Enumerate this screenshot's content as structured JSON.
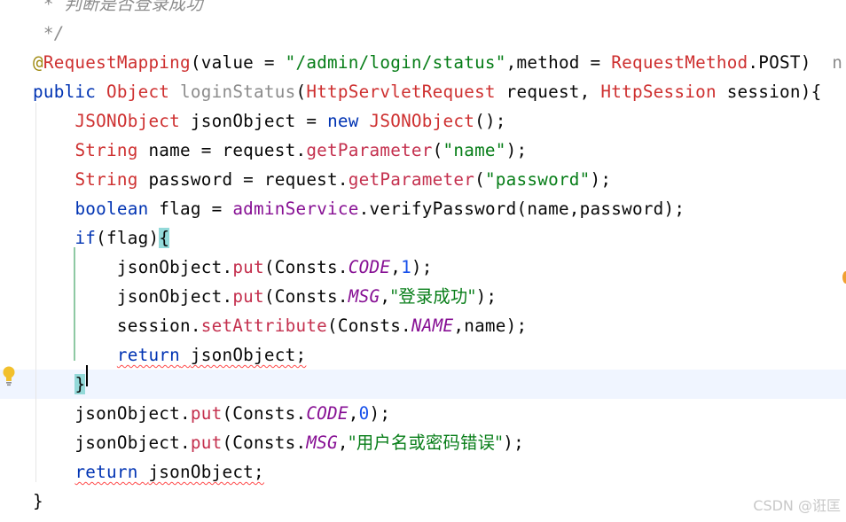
{
  "editor": {
    "lines": [
      {
        "text_parts": [
          {
            "t": " * 判断是否登录成功",
            "c": "cmt"
          }
        ]
      },
      {
        "text_parts": [
          {
            "t": " */",
            "c": "cmt"
          }
        ]
      },
      {
        "text_parts": [
          {
            "t": "@",
            "c": "ann"
          },
          {
            "t": "RequestMapping",
            "c": "cls"
          },
          {
            "t": "(value = ",
            "c": ""
          },
          {
            "t": "\"/admin/login/status\"",
            "c": "str"
          },
          {
            "t": ",method = ",
            "c": ""
          },
          {
            "t": "RequestMethod",
            "c": "cls"
          },
          {
            "t": ".POST)  ",
            "c": ""
          },
          {
            "t": "n",
            "c": "gray"
          }
        ]
      },
      {
        "text_parts": [
          {
            "t": "public ",
            "c": "kw"
          },
          {
            "t": "Object ",
            "c": "cls"
          },
          {
            "t": "loginStatus",
            "c": "gray"
          },
          {
            "t": "(",
            "c": ""
          },
          {
            "t": "HttpServletRequest",
            "c": "cls"
          },
          {
            "t": " request, ",
            "c": ""
          },
          {
            "t": "HttpSession",
            "c": "cls"
          },
          {
            "t": " session){",
            "c": ""
          }
        ]
      },
      {
        "text_parts": [
          {
            "t": "    ",
            "c": ""
          },
          {
            "t": "JSONObject",
            "c": "cls"
          },
          {
            "t": " jsonObject = ",
            "c": ""
          },
          {
            "t": "new ",
            "c": "kw"
          },
          {
            "t": "JSONObject",
            "c": "cls"
          },
          {
            "t": "();",
            "c": ""
          }
        ]
      },
      {
        "text_parts": [
          {
            "t": "    ",
            "c": ""
          },
          {
            "t": "String",
            "c": "cls"
          },
          {
            "t": " name = request.",
            "c": ""
          },
          {
            "t": "getParameter",
            "c": "mth"
          },
          {
            "t": "(",
            "c": ""
          },
          {
            "t": "\"name\"",
            "c": "str"
          },
          {
            "t": ");",
            "c": ""
          }
        ]
      },
      {
        "text_parts": [
          {
            "t": "    ",
            "c": ""
          },
          {
            "t": "String",
            "c": "cls"
          },
          {
            "t": " password = request.",
            "c": ""
          },
          {
            "t": "getParameter",
            "c": "mth"
          },
          {
            "t": "(",
            "c": ""
          },
          {
            "t": "\"password\"",
            "c": "str"
          },
          {
            "t": ");",
            "c": ""
          }
        ]
      },
      {
        "text_parts": [
          {
            "t": "    ",
            "c": ""
          },
          {
            "t": "boolean",
            "c": "kw"
          },
          {
            "t": " flag = ",
            "c": ""
          },
          {
            "t": "adminService",
            "c": "fld"
          },
          {
            "t": ".verifyPassword(name,password);",
            "c": ""
          }
        ]
      },
      {
        "text_parts": [
          {
            "t": "    ",
            "c": ""
          },
          {
            "t": "if",
            "c": "kw"
          },
          {
            "t": "(flag)",
            "c": ""
          },
          {
            "t": "{",
            "c": "match"
          }
        ]
      },
      {
        "text_parts": [
          {
            "t": "        jsonObject.",
            "c": ""
          },
          {
            "t": "put",
            "c": "mth"
          },
          {
            "t": "(Consts.",
            "c": ""
          },
          {
            "t": "CODE",
            "c": "cnst"
          },
          {
            "t": ",",
            "c": ""
          },
          {
            "t": "1",
            "c": "num"
          },
          {
            "t": ");",
            "c": ""
          }
        ]
      },
      {
        "text_parts": [
          {
            "t": "        jsonObject.",
            "c": ""
          },
          {
            "t": "put",
            "c": "mth"
          },
          {
            "t": "(Consts.",
            "c": ""
          },
          {
            "t": "MSG",
            "c": "cnst"
          },
          {
            "t": ",",
            "c": ""
          },
          {
            "t": "\"登录成功\"",
            "c": "str cjk"
          },
          {
            "t": ");",
            "c": ""
          }
        ]
      },
      {
        "text_parts": [
          {
            "t": "        session.",
            "c": ""
          },
          {
            "t": "setAttribute",
            "c": "mth"
          },
          {
            "t": "(Consts.",
            "c": ""
          },
          {
            "t": "NAME",
            "c": "cnst"
          },
          {
            "t": ",name);",
            "c": ""
          }
        ]
      },
      {
        "text_parts": [
          {
            "t": "        ",
            "c": ""
          },
          {
            "t": "return",
            "c": "kw err"
          },
          {
            "t": " ",
            "c": "err"
          },
          {
            "t": "jsonObject;",
            "c": "err"
          }
        ]
      },
      {
        "text_parts": [
          {
            "t": "    ",
            "c": ""
          },
          {
            "t": "}",
            "c": "match"
          }
        ],
        "current": true
      },
      {
        "text_parts": [
          {
            "t": "    jsonObject.",
            "c": ""
          },
          {
            "t": "put",
            "c": "mth"
          },
          {
            "t": "(Consts.",
            "c": ""
          },
          {
            "t": "CODE",
            "c": "cnst"
          },
          {
            "t": ",",
            "c": ""
          },
          {
            "t": "0",
            "c": "num"
          },
          {
            "t": ");",
            "c": ""
          }
        ]
      },
      {
        "text_parts": [
          {
            "t": "    jsonObject.",
            "c": ""
          },
          {
            "t": "put",
            "c": "mth"
          },
          {
            "t": "(Consts.",
            "c": ""
          },
          {
            "t": "MSG",
            "c": "cnst"
          },
          {
            "t": ",",
            "c": ""
          },
          {
            "t": "\"用户名或密码错误\"",
            "c": "str cjk"
          },
          {
            "t": ");",
            "c": ""
          }
        ]
      },
      {
        "text_parts": [
          {
            "t": "    ",
            "c": ""
          },
          {
            "t": "return",
            "c": "kw err"
          },
          {
            "t": " ",
            "c": "err"
          },
          {
            "t": "jsonObject;",
            "c": "err"
          }
        ]
      },
      {
        "text_parts": [
          {
            "t": "}",
            "c": ""
          }
        ]
      }
    ]
  },
  "gutter": {
    "intention_icon": "lightbulb-icon"
  },
  "watermark": "CSDN @诳匡",
  "colors": {
    "keyword": "#0033b3",
    "class": "#ce3030",
    "string": "#067d17",
    "method": "#c4304e",
    "field": "#871094",
    "number": "#1750eb",
    "comment": "#8c8c8c",
    "current_line": "#f0f5ff",
    "brace_match": "#93d9d9"
  }
}
